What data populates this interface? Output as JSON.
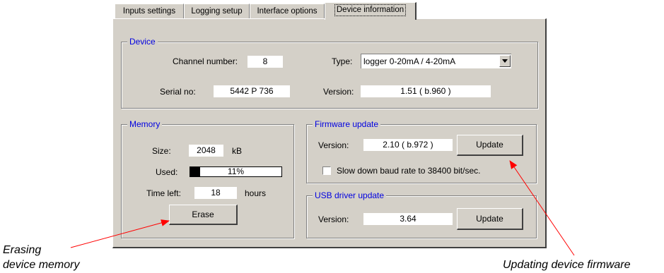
{
  "tabs": [
    {
      "label": "Inputs settings"
    },
    {
      "label": "Logging setup"
    },
    {
      "label": "Interface options"
    },
    {
      "label": "Device information"
    }
  ],
  "device": {
    "legend": "Device",
    "channel_label": "Channel number:",
    "channel_value": "8",
    "type_label": "Type:",
    "type_value": "logger  0-20mA / 4-20mA",
    "serial_label": "Serial no:",
    "serial_value": "5442 P 736",
    "version_label": "Version:",
    "version_value": "1.51  ( b.960 )"
  },
  "memory": {
    "legend": "Memory",
    "size_label": "Size:",
    "size_value": "2048",
    "size_unit": "kB",
    "used_label": "Used:",
    "used_text": "11%",
    "used_fraction": 0.11,
    "time_left_label": "Time left:",
    "time_left_value": "18",
    "time_left_unit": "hours",
    "erase_label": "Erase"
  },
  "firmware": {
    "legend": "Firmware update",
    "version_label": "Version:",
    "version_value": "2.10  ( b.972 )",
    "update_label": "Update",
    "slow_baud_label": "Slow down baud rate to 38400 bit/sec.",
    "slow_baud_checked": false
  },
  "usb": {
    "legend": "USB driver update",
    "version_label": "Version:",
    "version_value": "3.64",
    "update_label": "Update"
  },
  "annotations": {
    "erase_note_line1": "Erasing",
    "erase_note_line2": "device memory",
    "firmware_note": "Updating device firmware",
    "arrow_color": "#ff0000"
  },
  "colors": {
    "face": "#d4d0c8",
    "legend_text": "#0000e0"
  }
}
